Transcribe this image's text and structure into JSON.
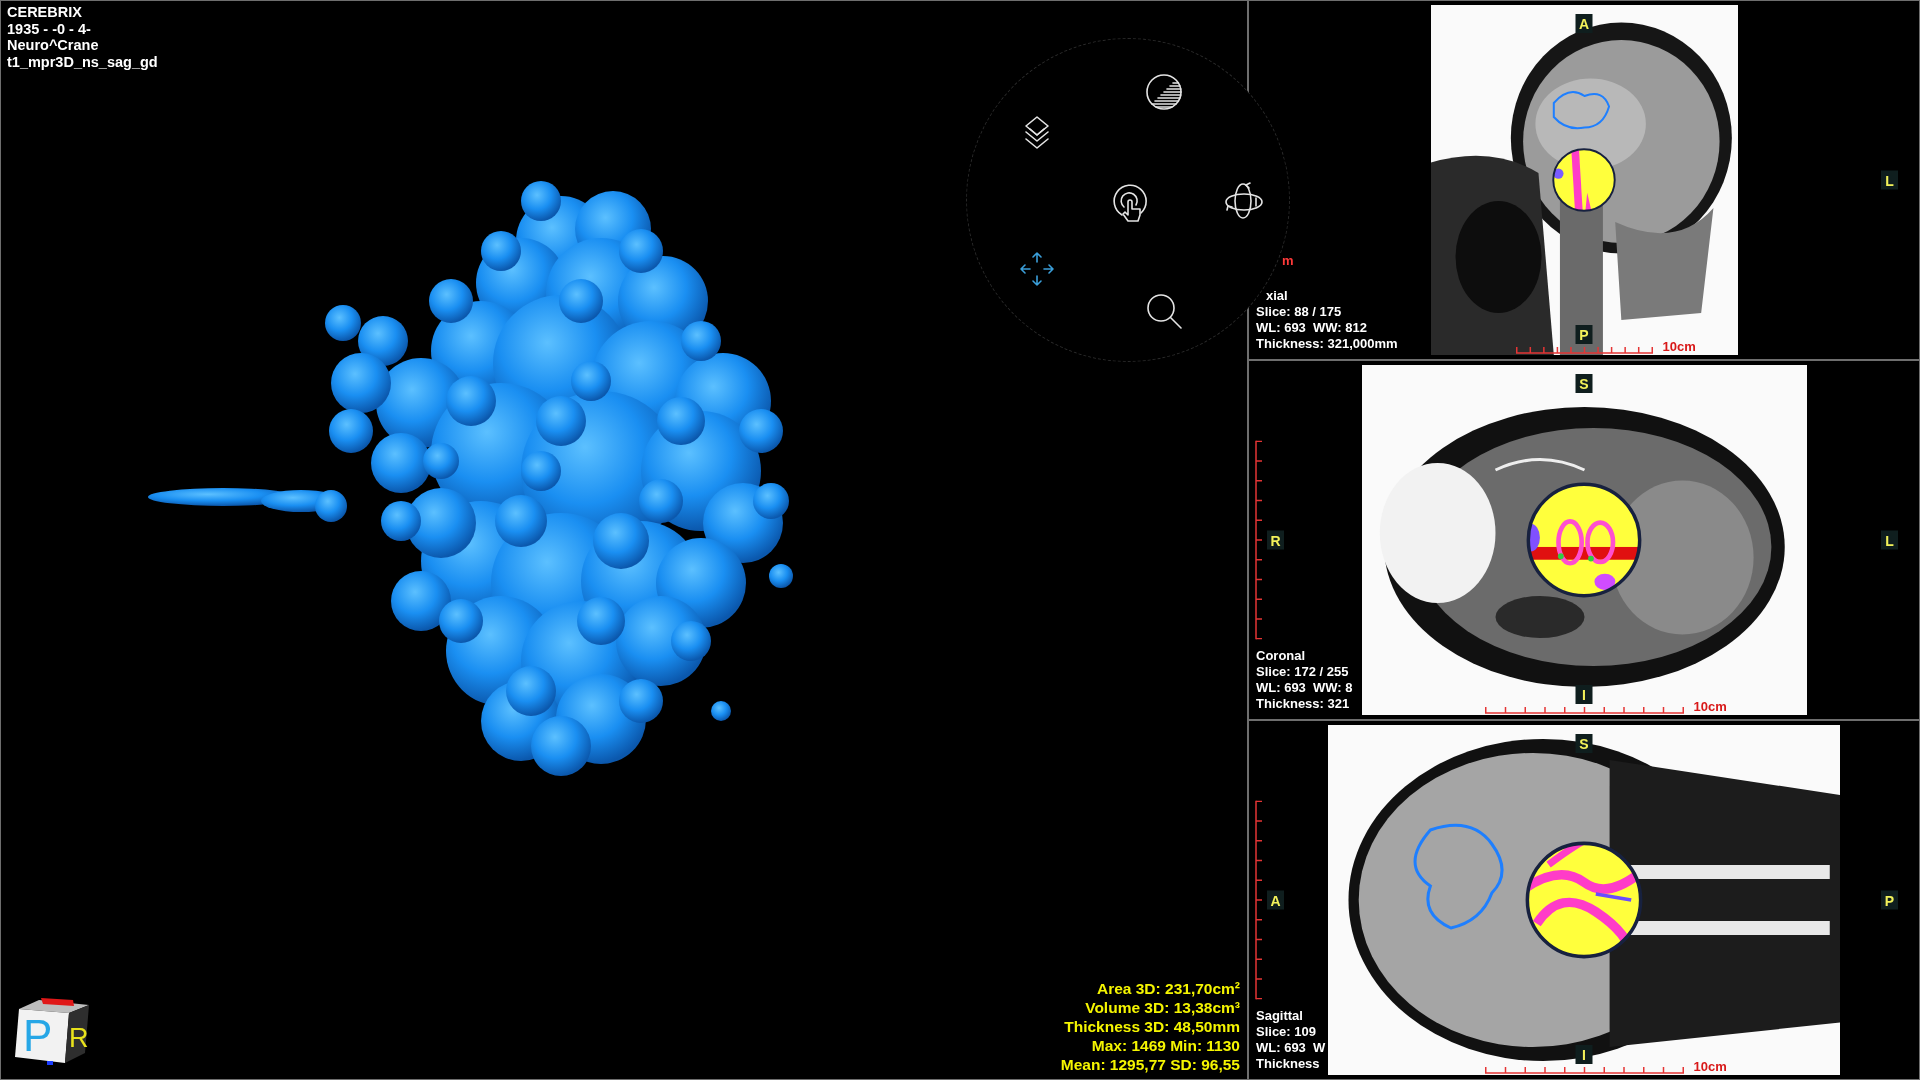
{
  "patient_info": [
    "CEREBRIX",
    "1935 - -0 - 4-",
    "Neuro^Crane",
    "t1_mpr3D_ns_sag_gd"
  ],
  "measurements": [
    "Area 3D: 231,70cm²",
    "Volume 3D: 13,38cm³",
    "Thickness 3D: 48,50mm",
    "Max: 1469 Min: 1130",
    "Mean: 1295,77 SD: 96,55"
  ],
  "orientation_cube": {
    "front_label": "P",
    "side_label": "R"
  },
  "radial_menu": {
    "tools": [
      {
        "kind": "contrast",
        "selected": false
      },
      {
        "kind": "layers",
        "selected": false
      },
      {
        "kind": "touch",
        "selected": false
      },
      {
        "kind": "rotate",
        "selected": false
      },
      {
        "kind": "move",
        "selected": true
      },
      {
        "kind": "zoom",
        "selected": false
      }
    ]
  },
  "views": [
    {
      "kind": "axial",
      "title": "xial",
      "info": [
        "Slice: 88 / 175",
        "WL: 693  WW: 812",
        "Thickness: 321,000mm"
      ],
      "labels": {
        "top": "A",
        "bottom": "P",
        "right": "L"
      },
      "scale_label": "10cm",
      "vertical_scale_label": "m"
    },
    {
      "kind": "coronal",
      "title": "Coronal",
      "info": [
        "Slice: 172 / 255",
        "WL: 693  WW: 8",
        "Thickness: 321"
      ],
      "labels": {
        "top": "S",
        "bottom": "I",
        "left": "R",
        "right": "L"
      },
      "scale_label": "10cm"
    },
    {
      "kind": "sagittal",
      "title": "Sagittal",
      "info": [
        "Slice: 109",
        "WL: 693  W",
        "Thickness"
      ],
      "labels": {
        "top": "S",
        "bottom": "I",
        "left": "A",
        "right": "P"
      },
      "scale_label": "10cm"
    }
  ]
}
